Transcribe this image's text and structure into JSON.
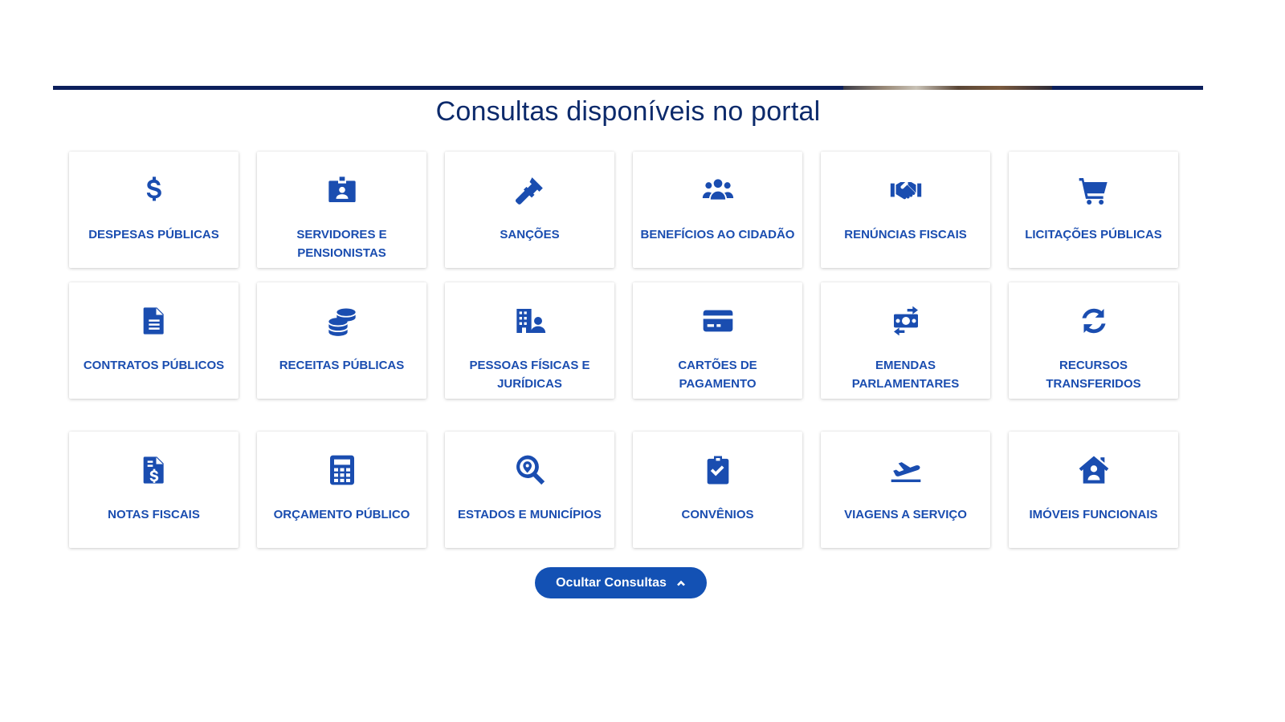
{
  "section": {
    "title": "Consultas disponíveis no portal"
  },
  "cards": [
    {
      "label": "DESPESAS PÚBLICAS",
      "icon": "dollar-icon"
    },
    {
      "label": "SERVIDORES E PENSIONISTAS",
      "icon": "id-badge-icon"
    },
    {
      "label": "SANÇÕES",
      "icon": "gavel-icon"
    },
    {
      "label": "BENEFÍCIOS AO CIDADÃO",
      "icon": "users-icon"
    },
    {
      "label": "RENÚNCIAS FISCAIS",
      "icon": "handshake-icon"
    },
    {
      "label": "LICITAÇÕES PÚBLICAS",
      "icon": "shopping-cart-icon"
    },
    {
      "label": "CONTRATOS PÚBLICOS",
      "icon": "document-icon"
    },
    {
      "label": "RECEITAS PÚBLICAS",
      "icon": "coins-icon"
    },
    {
      "label": "PESSOAS FÍSICAS E JURÍDICAS",
      "icon": "building-user-icon"
    },
    {
      "label": "CARTÕES DE PAGAMENTO",
      "icon": "credit-card-icon"
    },
    {
      "label": "EMENDAS PARLAMENTARES",
      "icon": "money-transfer-icon"
    },
    {
      "label": "RECURSOS TRANSFERIDOS",
      "icon": "sync-icon"
    },
    {
      "label": "NOTAS FISCAIS",
      "icon": "invoice-dollar-icon"
    },
    {
      "label": "ORÇAMENTO PÚBLICO",
      "icon": "calculator-icon"
    },
    {
      "label": "ESTADOS E MUNICÍPIOS",
      "icon": "map-search-icon"
    },
    {
      "label": "CONVÊNIOS",
      "icon": "clipboard-check-icon"
    },
    {
      "label": "VIAGENS A SERVIÇO",
      "icon": "plane-departure-icon"
    },
    {
      "label": "IMÓVEIS FUNCIONAIS",
      "icon": "house-user-icon"
    }
  ],
  "toggle": {
    "label": "Ocultar Consultas",
    "icon": "chevron-up-icon"
  },
  "colors": {
    "accent": "#1a4db0",
    "button": "#1351b4",
    "title": "#0c2a6b",
    "top_bar": "#0c1f5c"
  }
}
